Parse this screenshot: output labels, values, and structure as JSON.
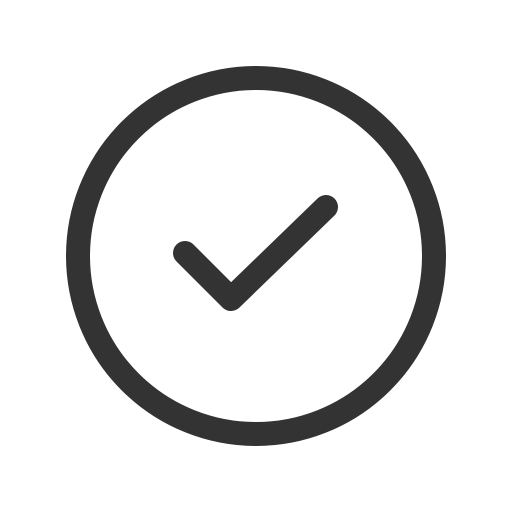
{
  "icon": {
    "name": "check-circle-icon",
    "stroke_color": "#333333",
    "background_color": "#ffffff"
  }
}
